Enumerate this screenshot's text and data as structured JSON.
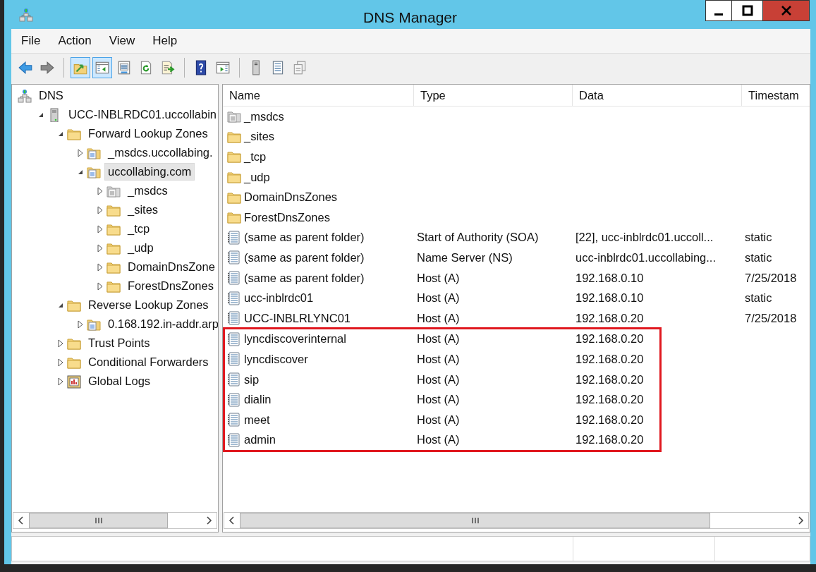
{
  "window": {
    "title": "DNS Manager"
  },
  "menu": [
    "File",
    "Action",
    "View",
    "Help"
  ],
  "toolbar": [
    {
      "kind": "back",
      "pressed": false
    },
    {
      "kind": "forward",
      "pressed": false
    },
    {
      "kind": "separator"
    },
    {
      "kind": "up",
      "pressed": true
    },
    {
      "kind": "console-tree",
      "pressed": true
    },
    {
      "kind": "properties",
      "pressed": false
    },
    {
      "kind": "refresh",
      "pressed": false
    },
    {
      "kind": "export",
      "pressed": false
    },
    {
      "kind": "separator"
    },
    {
      "kind": "help",
      "pressed": false
    },
    {
      "kind": "action-pane",
      "pressed": false
    },
    {
      "kind": "separator"
    },
    {
      "kind": "server",
      "pressed": false
    },
    {
      "kind": "records",
      "pressed": false
    },
    {
      "kind": "copy",
      "pressed": false
    }
  ],
  "tree": [
    {
      "label": "DNS",
      "kind": "dns",
      "selected": false,
      "children": [
        {
          "label": "UCC-INBLRDC01.uccollabin",
          "kind": "server",
          "expanded": true,
          "selected": false,
          "children": [
            {
              "label": "Forward Lookup Zones",
              "kind": "folder",
              "expanded": true,
              "selected": false,
              "children": [
                {
                  "label": "_msdcs.uccollabing.",
                  "kind": "zone",
                  "expanded": false,
                  "selected": false
                },
                {
                  "label": "uccollabing.com",
                  "kind": "zone",
                  "expanded": true,
                  "selected": true,
                  "children": [
                    {
                      "label": "_msdcs",
                      "kind": "zone-grey",
                      "expanded": false,
                      "selected": false
                    },
                    {
                      "label": "_sites",
                      "kind": "folder",
                      "expanded": false,
                      "selected": false
                    },
                    {
                      "label": "_tcp",
                      "kind": "folder",
                      "expanded": false,
                      "selected": false
                    },
                    {
                      "label": "_udp",
                      "kind": "folder",
                      "expanded": false,
                      "selected": false
                    },
                    {
                      "label": "DomainDnsZone",
                      "kind": "folder",
                      "expanded": false,
                      "selected": false
                    },
                    {
                      "label": "ForestDnsZones",
                      "kind": "folder",
                      "expanded": false,
                      "selected": false
                    }
                  ]
                }
              ]
            },
            {
              "label": "Reverse Lookup Zones",
              "kind": "folder",
              "expanded": true,
              "selected": false,
              "children": [
                {
                  "label": "0.168.192.in-addr.arp",
                  "kind": "zone",
                  "expanded": false,
                  "selected": false
                }
              ]
            },
            {
              "label": "Trust Points",
              "kind": "folder",
              "expanded": false,
              "selected": false
            },
            {
              "label": "Conditional Forwarders",
              "kind": "folder",
              "expanded": false,
              "selected": false
            },
            {
              "label": "Global Logs",
              "kind": "logs",
              "expanded": false,
              "selected": false
            }
          ]
        }
      ]
    }
  ],
  "list": {
    "columns": [
      "Name",
      "Type",
      "Data",
      "Timestam"
    ],
    "rows": [
      {
        "kind": "zone-grey",
        "name": "_msdcs",
        "highlighted": false
      },
      {
        "kind": "folder",
        "name": "_sites",
        "highlighted": false
      },
      {
        "kind": "folder",
        "name": "_tcp",
        "highlighted": false
      },
      {
        "kind": "folder",
        "name": "_udp",
        "highlighted": false
      },
      {
        "kind": "folder",
        "name": "DomainDnsZones",
        "highlighted": false
      },
      {
        "kind": "folder",
        "name": "ForestDnsZones",
        "highlighted": false
      },
      {
        "kind": "record",
        "name": "(same as parent folder)",
        "type": "Start of Authority (SOA)",
        "data": "[22], ucc-inblrdc01.uccoll...",
        "timestamp": "static",
        "highlighted": false
      },
      {
        "kind": "record",
        "name": "(same as parent folder)",
        "type": "Name Server (NS)",
        "data": "ucc-inblrdc01.uccollabing...",
        "timestamp": "static",
        "highlighted": false
      },
      {
        "kind": "record",
        "name": "(same as parent folder)",
        "type": "Host (A)",
        "data": "192.168.0.10",
        "timestamp": "7/25/2018",
        "highlighted": false
      },
      {
        "kind": "record",
        "name": "ucc-inblrdc01",
        "type": "Host (A)",
        "data": "192.168.0.10",
        "timestamp": "static",
        "highlighted": false
      },
      {
        "kind": "record",
        "name": "UCC-INBLRLYNC01",
        "type": "Host (A)",
        "data": "192.168.0.20",
        "timestamp": "7/25/2018",
        "highlighted": false
      },
      {
        "kind": "record",
        "name": "lyncdiscoverinternal",
        "type": "Host (A)",
        "data": "192.168.0.20",
        "highlighted": true
      },
      {
        "kind": "record",
        "name": "lyncdiscover",
        "type": "Host (A)",
        "data": "192.168.0.20",
        "highlighted": true
      },
      {
        "kind": "record",
        "name": "sip",
        "type": "Host (A)",
        "data": "192.168.0.20",
        "highlighted": true
      },
      {
        "kind": "record",
        "name": "dialin",
        "type": "Host (A)",
        "data": "192.168.0.20",
        "highlighted": true
      },
      {
        "kind": "record",
        "name": "meet",
        "type": "Host (A)",
        "data": "192.168.0.20",
        "highlighted": true
      },
      {
        "kind": "record",
        "name": "admin",
        "type": "Host (A)",
        "data": "192.168.0.20",
        "highlighted": true
      }
    ]
  }
}
